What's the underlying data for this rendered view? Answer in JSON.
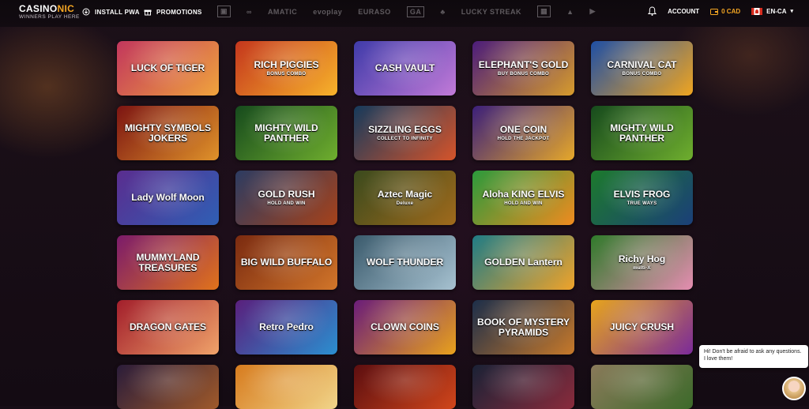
{
  "brand": {
    "name_a": "CASINO",
    "name_b": "NIC",
    "tagline": "WINNERS PLAY HERE"
  },
  "nav": {
    "install": "INSTALL PWA",
    "promotions": "PROMOTIONS"
  },
  "providers": [
    "∞",
    "AMATIC",
    "evoplay",
    "EURASO",
    "GA",
    "♣",
    "LUCKY STREAK"
  ],
  "account": {
    "label": "ACCOUNT",
    "balance": "0 CAD",
    "locale": "EN-CA"
  },
  "games": [
    {
      "title": "LUCK OF TIGER",
      "sub": "",
      "bg": "#c2365d",
      "bg2": "#f0a43c"
    },
    {
      "title": "RICH PIGGIES",
      "sub": "BONUS COMBO",
      "bg": "#c4361d",
      "bg2": "#f7b32b"
    },
    {
      "title": "CASH VAULT",
      "sub": "",
      "bg": "#3f3ba9",
      "bg2": "#c27ad8"
    },
    {
      "title": "ELEPHANT'S GOLD",
      "sub": "BUY BONUS COMBO",
      "bg": "#4b1c7b",
      "bg2": "#d79c2c"
    },
    {
      "title": "CARNIVAL CAT",
      "sub": "BONUS COMBO",
      "bg": "#1e4fa6",
      "bg2": "#f0a520"
    },
    {
      "title": "MIGHTY SYMBOLS JOKERS",
      "sub": "",
      "bg": "#7c1412",
      "bg2": "#e0932a"
    },
    {
      "title": "MIGHTY WILD PANTHER",
      "sub": "",
      "bg": "#164a1d",
      "bg2": "#6fae2e"
    },
    {
      "title": "SIZZLING EGGS",
      "sub": "COLLECT TO INFINITY",
      "bg": "#153a5c",
      "bg2": "#d6542a"
    },
    {
      "title": "ONE COIN",
      "sub": "HOLD THE JACKPOT",
      "bg": "#3b1f7b",
      "bg2": "#e6a82a"
    },
    {
      "title": "MIGHTY WILD PANTHER",
      "sub": "",
      "bg": "#164a1d",
      "bg2": "#6fae2e"
    },
    {
      "title": "Lady Wolf Moon",
      "sub": "",
      "bg": "#5a2d8f",
      "bg2": "#2f5fb5"
    },
    {
      "title": "GOLD RUSH",
      "sub": "HOLD AND WIN",
      "bg": "#2c3c62",
      "bg2": "#a6421a"
    },
    {
      "title": "Aztec Magic",
      "sub": "Deluxe",
      "bg": "#3a4a1d",
      "bg2": "#a06a1c"
    },
    {
      "title": "Aloha KING ELVIS",
      "sub": "HOLD AND WIN",
      "bg": "#2b9a3c",
      "bg2": "#f08b1f"
    },
    {
      "title": "ELVIS FROG",
      "sub": "TRUE WAYS",
      "bg": "#1c7a2c",
      "bg2": "#1b3f79"
    },
    {
      "title": "MUMMYLAND TREASURES",
      "sub": "",
      "bg": "#7b1b6b",
      "bg2": "#e1731b"
    },
    {
      "title": "BIG WILD BUFFALO",
      "sub": "",
      "bg": "#7a2a10",
      "bg2": "#d2762a"
    },
    {
      "title": "WOLF THUNDER",
      "sub": "",
      "bg": "#3a5a6c",
      "bg2": "#a7c2d1"
    },
    {
      "title": "GOLDEN Lantern",
      "sub": "",
      "bg": "#1f7c86",
      "bg2": "#f0a32a"
    },
    {
      "title": "Richy Hog",
      "sub": "multi-X",
      "bg": "#2f7a2a",
      "bg2": "#e58db1"
    },
    {
      "title": "DRAGON GATES",
      "sub": "",
      "bg": "#a21e2b",
      "bg2": "#f0a36a"
    },
    {
      "title": "Retro Pedro",
      "sub": "",
      "bg": "#5a1f7c",
      "bg2": "#2b8fd0"
    },
    {
      "title": "CLOWN COINS",
      "sub": "",
      "bg": "#6a1c7a",
      "bg2": "#e9a21c"
    },
    {
      "title": "BOOK OF MYSTERY PYRAMIDS",
      "sub": "",
      "bg": "#1c2e4a",
      "bg2": "#c7792a"
    },
    {
      "title": "JUICY CRUSH",
      "sub": "",
      "bg": "#e7a51c",
      "bg2": "#7b2a9a"
    },
    {
      "title": "",
      "sub": "",
      "bg": "#2a1c3a",
      "bg2": "#a05a2a"
    },
    {
      "title": "",
      "sub": "",
      "bg": "#d77b1e",
      "bg2": "#f1d58a"
    },
    {
      "title": "",
      "sub": "",
      "bg": "#5c0e10",
      "bg2": "#d1461b"
    },
    {
      "title": "",
      "sub": "",
      "bg": "#1a2236",
      "bg2": "#8a2b3c"
    },
    {
      "title": "",
      "sub": "",
      "bg": "#8a7a5a",
      "bg2": "#3c6a2a"
    }
  ],
  "chat": {
    "message": "Hi! Don't be afraid to ask any questions. I love them!"
  }
}
